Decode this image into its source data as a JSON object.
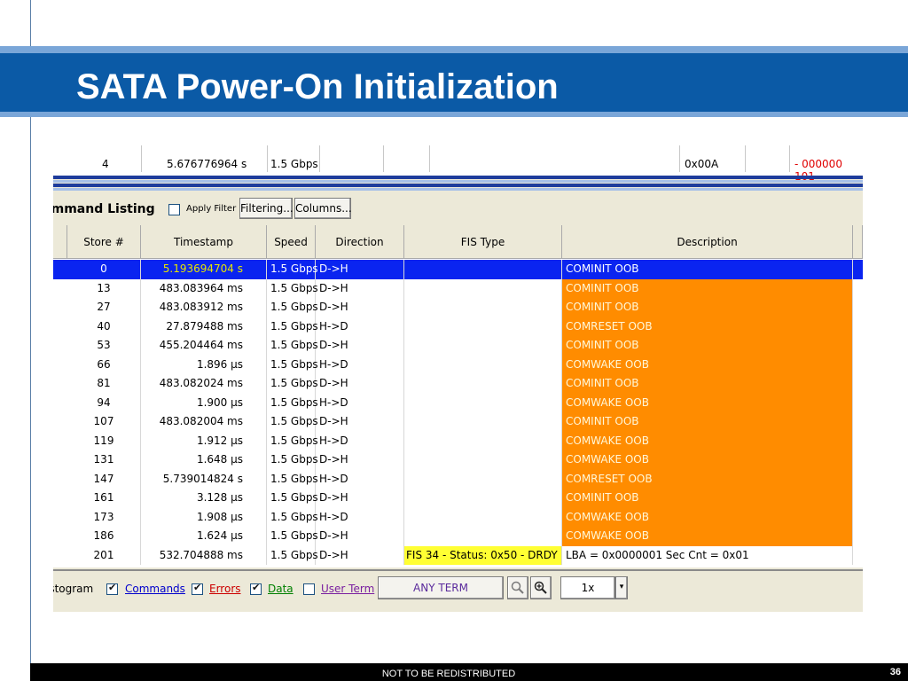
{
  "slide": {
    "title": "SATA Power-On Initialization",
    "footer_note": "NOT TO BE REDISTRIBUTED",
    "page_number": "36",
    "accent_color": "#0b5aa6"
  },
  "top_row": {
    "store": "4",
    "timestamp": "5.676776964 s",
    "speed": "1.5 Gbps",
    "value": "0x00A",
    "trail": "- 000000 101"
  },
  "toolbar": {
    "section_label": "ommand Listing",
    "apply_filter_label": "Apply Filter",
    "filtering_button": "Filtering...",
    "columns_button": "Columns..."
  },
  "table": {
    "headers": [
      "Store #",
      "Timestamp",
      "Speed",
      "Direction",
      "FIS Type",
      "Description"
    ],
    "rows": [
      {
        "store": "0",
        "timestamp": "5.193694704 s",
        "speed": "1.5 Gbps",
        "direction": "D->H",
        "fis": "",
        "description": "COMINIT OOB"
      },
      {
        "store": "13",
        "timestamp": "483.083964 ms",
        "speed": "1.5 Gbps",
        "direction": "D->H",
        "fis": "",
        "description": "COMINIT OOB"
      },
      {
        "store": "27",
        "timestamp": "483.083912 ms",
        "speed": "1.5 Gbps",
        "direction": "D->H",
        "fis": "",
        "description": "COMINIT OOB"
      },
      {
        "store": "40",
        "timestamp": "27.879488 ms",
        "speed": "1.5 Gbps",
        "direction": "H->D",
        "fis": "",
        "description": "COMRESET OOB"
      },
      {
        "store": "53",
        "timestamp": "455.204464 ms",
        "speed": "1.5 Gbps",
        "direction": "D->H",
        "fis": "",
        "description": "COMINIT OOB"
      },
      {
        "store": "66",
        "timestamp": "1.896 µs",
        "speed": "1.5 Gbps",
        "direction": "H->D",
        "fis": "",
        "description": "COMWAKE OOB"
      },
      {
        "store": "81",
        "timestamp": "483.082024 ms",
        "speed": "1.5 Gbps",
        "direction": "D->H",
        "fis": "",
        "description": "COMINIT OOB"
      },
      {
        "store": "94",
        "timestamp": "1.900 µs",
        "speed": "1.5 Gbps",
        "direction": "H->D",
        "fis": "",
        "description": "COMWAKE OOB"
      },
      {
        "store": "107",
        "timestamp": "483.082004 ms",
        "speed": "1.5 Gbps",
        "direction": "D->H",
        "fis": "",
        "description": "COMINIT OOB"
      },
      {
        "store": "119",
        "timestamp": "1.912 µs",
        "speed": "1.5 Gbps",
        "direction": "H->D",
        "fis": "",
        "description": "COMWAKE OOB"
      },
      {
        "store": "131",
        "timestamp": "1.648 µs",
        "speed": "1.5 Gbps",
        "direction": "D->H",
        "fis": "",
        "description": "COMWAKE OOB"
      },
      {
        "store": "147",
        "timestamp": "5.739014824 s",
        "speed": "1.5 Gbps",
        "direction": "H->D",
        "fis": "",
        "description": "COMRESET OOB"
      },
      {
        "store": "161",
        "timestamp": "3.128 µs",
        "speed": "1.5 Gbps",
        "direction": "D->H",
        "fis": "",
        "description": "COMINIT OOB"
      },
      {
        "store": "173",
        "timestamp": "1.908 µs",
        "speed": "1.5 Gbps",
        "direction": "H->D",
        "fis": "",
        "description": "COMWAKE OOB"
      },
      {
        "store": "186",
        "timestamp": "1.624 µs",
        "speed": "1.5 Gbps",
        "direction": "D->H",
        "fis": "",
        "description": "COMWAKE OOB"
      },
      {
        "store": "201",
        "timestamp": "532.704888 ms",
        "speed": "1.5 Gbps",
        "direction": "D->H",
        "fis": "FIS 34 - Status: 0x50 -   DRDY",
        "description": "LBA = 0x0000001  Sec Cnt = 0x01"
      }
    ],
    "colors": {
      "selected": "#0a24f0",
      "oob": "#ff8c00",
      "fis": "#ffff33"
    }
  },
  "bottom_bar": {
    "histogram_label": "istogram",
    "commands_label": "Commands",
    "errors_label": "Errors",
    "data_label": "Data",
    "user_term_label": "User Term",
    "any_term_button": "ANY TERM",
    "zoom_value": "1x",
    "commands_color": "#0000cc",
    "errors_color": "#cc0000",
    "data_color": "#008000",
    "user_term_color": "#7a1fa0"
  }
}
